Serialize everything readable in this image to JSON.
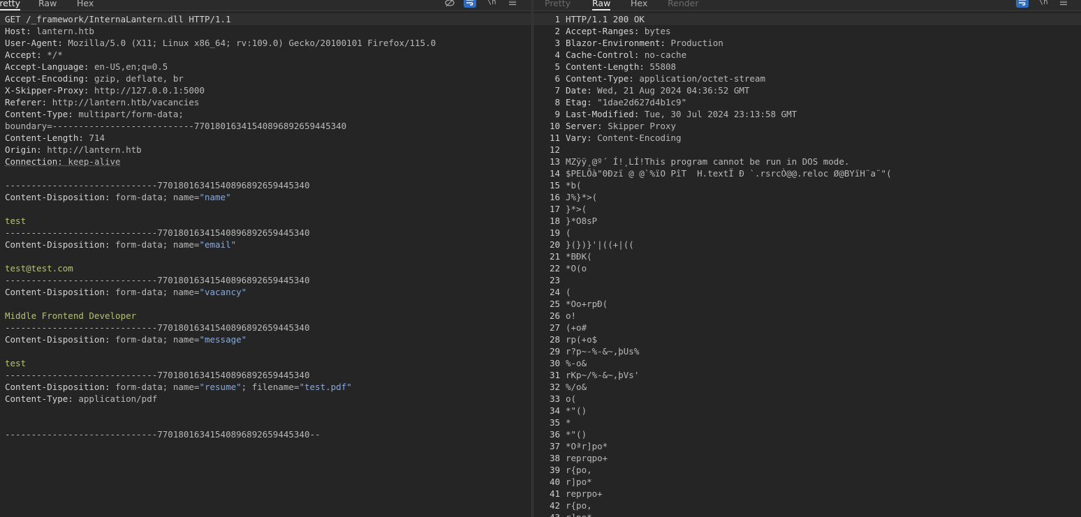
{
  "request": {
    "tabs": [
      "Pretty",
      "Raw",
      "Hex"
    ],
    "active_tab": "Pretty",
    "lines": [
      {
        "k": "GET /_framework/InternaLantern.dll HTTP/1.1",
        "v": ""
      },
      {
        "k": "Host:",
        "v": " lantern.htb"
      },
      {
        "k": "User-Agent:",
        "v": " Mozilla/5.0 (X11; Linux x86_64; rv:109.0) Gecko/20100101 Firefox/115.0"
      },
      {
        "k": "Accept:",
        "v": " */*"
      },
      {
        "k": "Accept-Language:",
        "v": " en-US,en;q=0.5"
      },
      {
        "k": "Accept-Encoding:",
        "v": " gzip, deflate, br"
      },
      {
        "k": "X-Skipper-Proxy:",
        "v": " http://127.0.0.1:5000"
      },
      {
        "k": "Referer:",
        "v": " http://lantern.htb/vacancies"
      },
      {
        "k": "Content-Type:",
        "v": " multipart/form-data;"
      },
      {
        "k": "",
        "v": "boundary=---------------------------77018016341540896892659445340"
      },
      {
        "k": "Content-Length:",
        "v": " 714"
      },
      {
        "k": "Origin:",
        "v": " http://lantern.htb"
      },
      {
        "k": "Connection:",
        "v": " keep-alive"
      },
      {
        "k": "",
        "v": ""
      },
      {
        "k": "",
        "v": "-----------------------------77018016341540896892659445340"
      },
      {
        "k": "Content-Disposition:",
        "v": " form-data; name=",
        "q": "\"name\""
      },
      {
        "k": "",
        "v": ""
      },
      {
        "k": "",
        "v": "",
        "t": "test"
      },
      {
        "k": "",
        "v": "-----------------------------77018016341540896892659445340"
      },
      {
        "k": "Content-Disposition:",
        "v": " form-data; name=",
        "q": "\"email\""
      },
      {
        "k": "",
        "v": ""
      },
      {
        "k": "",
        "v": "",
        "t": "test@test.com"
      },
      {
        "k": "",
        "v": "-----------------------------77018016341540896892659445340"
      },
      {
        "k": "Content-Disposition:",
        "v": " form-data; name=",
        "q": "\"vacancy\""
      },
      {
        "k": "",
        "v": ""
      },
      {
        "k": "",
        "v": "",
        "t": "Middle Frontend Developer"
      },
      {
        "k": "",
        "v": "-----------------------------77018016341540896892659445340"
      },
      {
        "k": "Content-Disposition:",
        "v": " form-data; name=",
        "q": "\"message\""
      },
      {
        "k": "",
        "v": ""
      },
      {
        "k": "",
        "v": "",
        "t": "test"
      },
      {
        "k": "",
        "v": "-----------------------------77018016341540896892659445340"
      },
      {
        "k": "Content-Disposition:",
        "v": " form-data; name=",
        "q": "\"resume\"",
        "v2": "; filename=",
        "q2": "\"test.pdf\""
      },
      {
        "k": "Content-Type:",
        "v": " application/pdf"
      },
      {
        "k": "",
        "v": ""
      },
      {
        "k": "",
        "v": ""
      },
      {
        "k": "",
        "v": "-----------------------------77018016341540896892659445340--"
      }
    ]
  },
  "response": {
    "tabs": [
      "Pretty",
      "Raw",
      "Hex",
      "Render"
    ],
    "active_tab": "Raw",
    "lines": [
      {
        "n": "1",
        "k": "HTTP/1.1 200 OK",
        "v": ""
      },
      {
        "n": "2",
        "k": "Accept-Ranges:",
        "v": " bytes"
      },
      {
        "n": "3",
        "k": "Blazor-Environment:",
        "v": " Production"
      },
      {
        "n": "4",
        "k": "Cache-Control:",
        "v": " no-cache"
      },
      {
        "n": "5",
        "k": "Content-Length:",
        "v": " 55808"
      },
      {
        "n": "6",
        "k": "Content-Type:",
        "v": " application/octet-stream"
      },
      {
        "n": "7",
        "k": "Date:",
        "v": " Wed, 21 Aug 2024 04:36:52 GMT"
      },
      {
        "n": "8",
        "k": "Etag:",
        "v": " \"1dae2d627d4b1c9\""
      },
      {
        "n": "9",
        "k": "Last-Modified:",
        "v": " Tue, 30 Jul 2024 23:13:58 GMT"
      },
      {
        "n": "10",
        "k": "Server:",
        "v": " Skipper Proxy"
      },
      {
        "n": "11",
        "k": "Vary:",
        "v": " Content-Encoding"
      },
      {
        "n": "12",
        "k": "",
        "v": ""
      },
      {
        "n": "13",
        "k": "",
        "v": "MZÿÿ¸@º´ Í!¸LÍ!This program cannot be run in DOS mode."
      },
      {
        "n": "14",
        "k": "",
        "v": "$PELÕà\"0Ðzï @ @`%ïO PîT  H.textÏ Ð `.rsrcÒ@@.reloc Ø@BYïH¨a¨\"("
      },
      {
        "n": "15",
        "k": "",
        "v": "*b("
      },
      {
        "n": "16",
        "k": "",
        "v": "J%}*>("
      },
      {
        "n": "17",
        "k": "",
        "v": "}*>("
      },
      {
        "n": "18",
        "k": "",
        "v": "}*O8sP"
      },
      {
        "n": "19",
        "k": "",
        "v": "("
      },
      {
        "n": "20",
        "k": "",
        "v": "}(})}'|((+|(("
      },
      {
        "n": "21",
        "k": "",
        "v": "*BÐK("
      },
      {
        "n": "22",
        "k": "",
        "v": "*O(o"
      },
      {
        "n": "23",
        "k": "",
        "v": ""
      },
      {
        "n": "24",
        "k": "",
        "v": "("
      },
      {
        "n": "25",
        "k": "",
        "v": "*Oo+rpÐ("
      },
      {
        "n": "26",
        "k": "",
        "v": "o!"
      },
      {
        "n": "27",
        "k": "",
        "v": "(+o#"
      },
      {
        "n": "28",
        "k": "",
        "v": "rp(+o$"
      },
      {
        "n": "29",
        "k": "",
        "v": "r?p~-%-&~,þUs%"
      },
      {
        "n": "30",
        "k": "",
        "v": "%-o&"
      },
      {
        "n": "31",
        "k": "",
        "v": "rKp~/%-&~,þVs'"
      },
      {
        "n": "32",
        "k": "",
        "v": "%/o&"
      },
      {
        "n": "33",
        "k": "",
        "v": "o("
      },
      {
        "n": "34",
        "k": "",
        "v": "*\"()"
      },
      {
        "n": "35",
        "k": "",
        "v": "*"
      },
      {
        "n": "36",
        "k": "",
        "v": "*\"()"
      },
      {
        "n": "37",
        "k": "",
        "v": "*Oªr]po*"
      },
      {
        "n": "38",
        "k": "",
        "v": "reprqpo+"
      },
      {
        "n": "39",
        "k": "",
        "v": "r{po,"
      },
      {
        "n": "40",
        "k": "",
        "v": "r]po*"
      },
      {
        "n": "41",
        "k": "",
        "v": "reprpo+"
      },
      {
        "n": "42",
        "k": "",
        "v": "r{po,"
      },
      {
        "n": "43",
        "k": "",
        "v": "r]po*"
      }
    ]
  },
  "toolbar_icons": [
    "hide-nonprintable-icon",
    "wrap-lines-icon",
    "newline-icon",
    "menu-icon"
  ],
  "colors": {
    "background": "#252526",
    "tab_bar": "#2b2b2b",
    "accent": "#2e6dc2",
    "form_value": "#b5c178",
    "quoted": "#8aa9d6"
  }
}
